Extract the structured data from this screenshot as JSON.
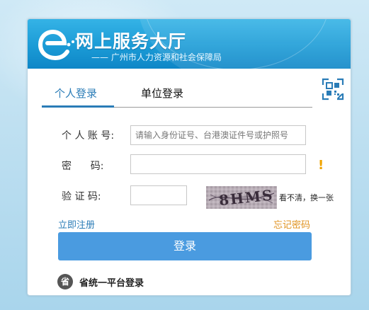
{
  "header": {
    "title": "网上服务大厅",
    "subtitle": "—— 广州市人力资源和社会保障局",
    "logo_icon": "e-logo-icon"
  },
  "tabs": [
    {
      "label": "个人登录",
      "active": true
    },
    {
      "label": "单位登录",
      "active": false
    }
  ],
  "qr_icon": "qr-code-icon",
  "form": {
    "account_label": "个 人 账 号:",
    "account_placeholder": "请输入身份证号、台港澳证件号或护照号",
    "password_label": "密      码:",
    "password_value": "",
    "captcha_label": "验 证 码:",
    "captcha_value": "",
    "captcha_text": "8HMS",
    "captcha_refresh": "看不清，换一张",
    "warning_mark": "!"
  },
  "links": {
    "register": "立即注册",
    "forgot": "忘记密码"
  },
  "login_button": "登录",
  "province_login": {
    "icon_text": "省",
    "label": "省统一平台登录"
  },
  "colors": {
    "accent": "#2a7cb7",
    "button": "#4a9be0",
    "warning": "#f0a400",
    "forgot": "#e09321"
  }
}
